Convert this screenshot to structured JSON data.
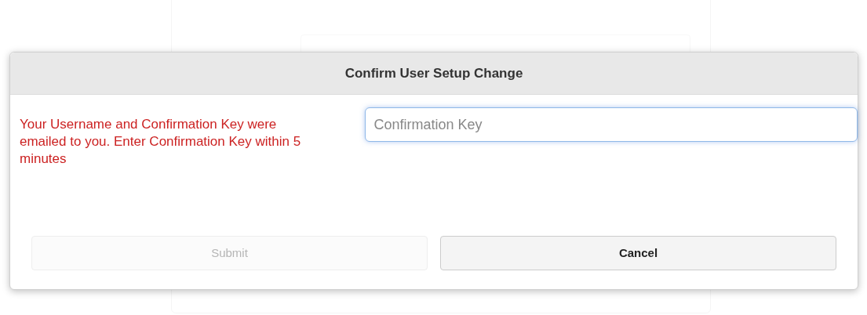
{
  "dialog": {
    "title": "Confirm User Setup Change",
    "message": "Your Username and Confirmation Key were emailed to you. Enter Confirmation Key within 5 minutes",
    "confirmation_field": {
      "placeholder": "Confirmation Key",
      "focused": true
    },
    "buttons": [
      {
        "label": "Submit",
        "disabled": true
      },
      {
        "label": "Cancel",
        "disabled": false
      }
    ]
  }
}
